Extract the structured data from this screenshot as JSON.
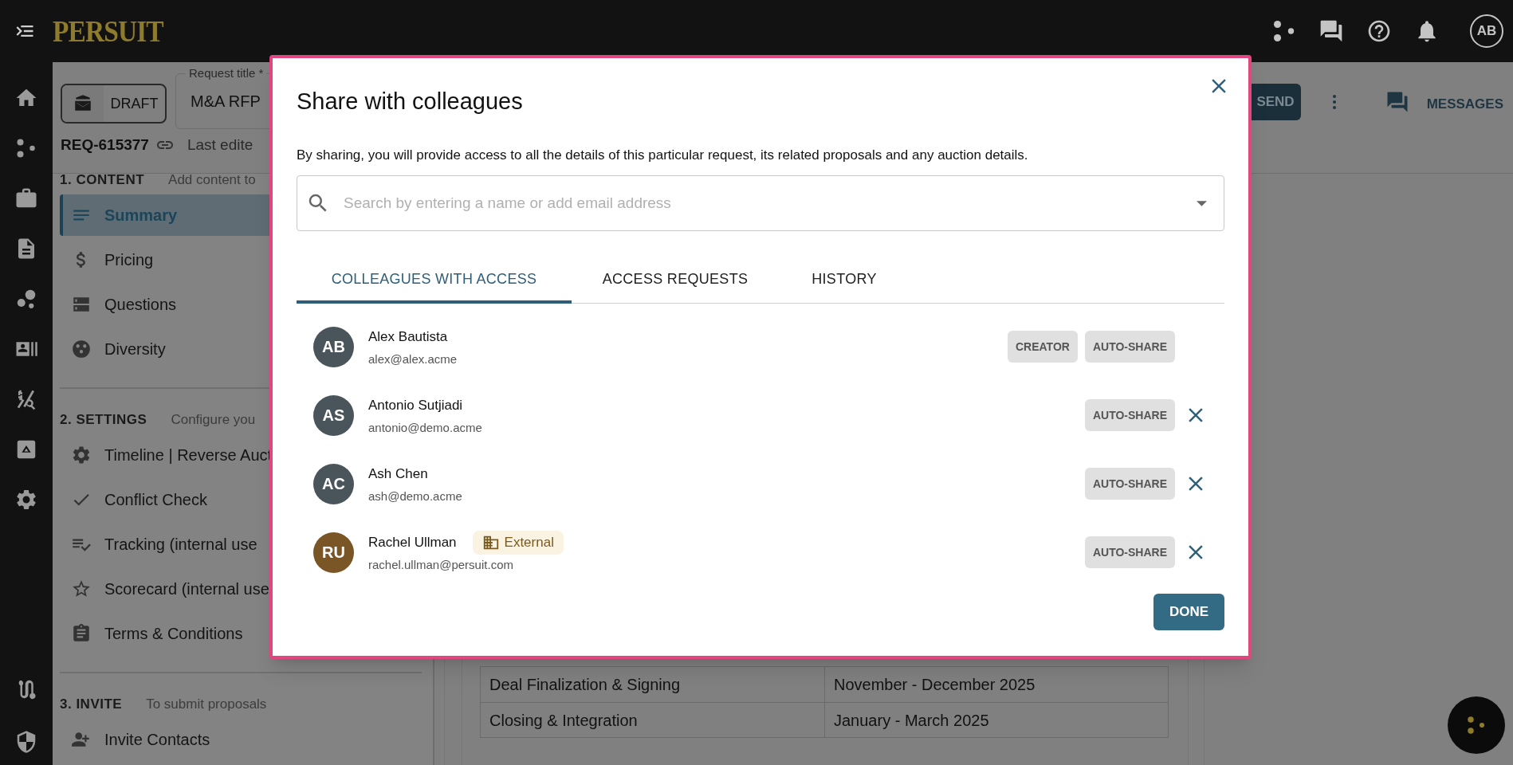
{
  "top_bar": {
    "logo": "PERSUIT",
    "avatar_initials": "AB"
  },
  "request_header": {
    "status": "DRAFT",
    "title_label": "Request title *",
    "title_value": "M&A RFP",
    "request_id": "REQ-615377",
    "last_edited": "Last edite",
    "send_button": "SEND",
    "messages_button": "MESSAGES"
  },
  "nav_sections": [
    {
      "heading": "1. CONTENT",
      "hint": "Add content to",
      "items": [
        {
          "label": "Summary",
          "selected": true
        },
        {
          "label": "Pricing",
          "selected": false
        },
        {
          "label": "Questions",
          "selected": false
        },
        {
          "label": "Diversity",
          "selected": false
        }
      ]
    },
    {
      "heading": "2. SETTINGS",
      "hint": "Configure you",
      "items": [
        {
          "label": "Timeline | Reverse Auct",
          "selected": false
        },
        {
          "label": "Conflict Check",
          "selected": false
        },
        {
          "label": "Tracking (internal use",
          "selected": false
        },
        {
          "label": "Scorecard (internal use",
          "selected": false
        },
        {
          "label": "Terms & Conditions",
          "selected": false
        }
      ]
    },
    {
      "heading": "3. INVITE",
      "hint": "To submit proposals",
      "items": [
        {
          "label": "Invite Contacts",
          "selected": false
        }
      ]
    }
  ],
  "background_table": {
    "rows": [
      [
        "Deal Finalization & Signing",
        "November - December 2025"
      ],
      [
        "Closing & Integration",
        "January - March 2025"
      ]
    ]
  },
  "modal": {
    "title": "Share with colleagues",
    "description": "By sharing, you will provide access to all the details of this particular request, its related proposals and any auction details.",
    "search": {
      "placeholder": "Search by entering a name or add email address"
    },
    "tabs": [
      {
        "label": "COLLEAGUES WITH ACCESS",
        "selected": true
      },
      {
        "label": "ACCESS REQUESTS",
        "selected": false
      },
      {
        "label": "HISTORY",
        "selected": false
      }
    ],
    "colleagues": [
      {
        "initials": "AB",
        "name": "Alex Bautista",
        "email": "alex@alex.acme",
        "color": "#4a545b",
        "tags": [
          "CREATOR",
          "AUTO-SHARE"
        ],
        "removable": false
      },
      {
        "initials": "AS",
        "name": "Antonio Sutjiadi",
        "email": "antonio@demo.acme",
        "color": "#4a545b",
        "tags": [
          "AUTO-SHARE"
        ],
        "removable": true
      },
      {
        "initials": "AC",
        "name": "Ash Chen",
        "email": "ash@demo.acme",
        "color": "#4a545b",
        "tags": [
          "AUTO-SHARE"
        ],
        "removable": true
      },
      {
        "initials": "RU",
        "name": "Rachel Ullman",
        "email": "rachel.ullman@persuit.com",
        "color": "#7a5526",
        "badge": "External",
        "tags": [
          "AUTO-SHARE"
        ],
        "removable": true
      }
    ],
    "done_button": "DONE"
  }
}
